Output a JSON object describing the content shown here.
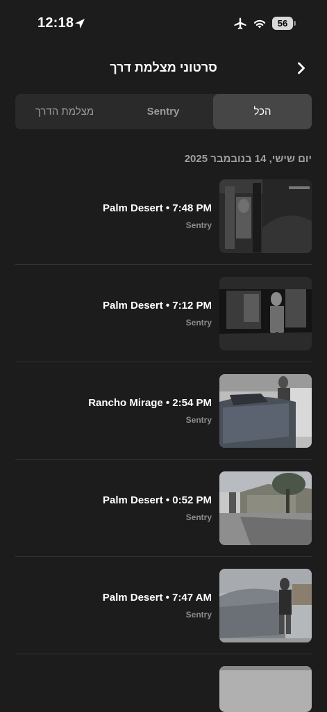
{
  "status_bar": {
    "time": "12:18",
    "battery": "56",
    "icons": [
      "location-arrow-icon",
      "airplane-icon",
      "wifi-icon",
      "battery-icon"
    ]
  },
  "header": {
    "title": "סרטוני מצלמת דרך",
    "back_icon": "chevron-right-icon"
  },
  "tabs": {
    "dashcam": "מצלמת הדרך",
    "sentry": "Sentry",
    "all": "הכל",
    "selected": "all"
  },
  "date_header": "יום שישי, 14 בנובמבר 2025",
  "clips": [
    {
      "title": "Palm Desert • 7:48 PM",
      "type": "Sentry"
    },
    {
      "title": "Palm Desert • 7:12 PM",
      "type": "Sentry"
    },
    {
      "title": "Rancho Mirage • 2:54 PM",
      "type": "Sentry"
    },
    {
      "title": "Palm Desert • 0:52 PM",
      "type": "Sentry"
    },
    {
      "title": "Palm Desert • 7:47 AM",
      "type": "Sentry"
    }
  ],
  "colors": {
    "background": "#1c1c1d",
    "segment_bg": "#2a2a2b",
    "segment_selected": "#464647",
    "secondary_text": "#8c8c8c"
  }
}
